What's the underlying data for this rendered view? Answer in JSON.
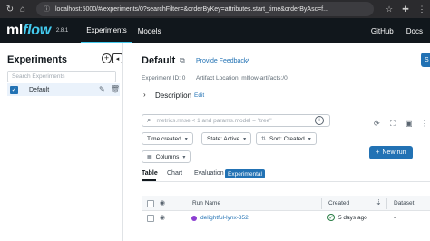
{
  "browser": {
    "url": "localhost:5000/#/experiments/0?searchFilter=&orderByKey=attributes.start_time&orderByAsc=f..."
  },
  "header": {
    "logo_ml": "ml",
    "logo_flow": "flow",
    "version": "2.8.1",
    "tabs": [
      {
        "label": "Experiments",
        "active": true
      },
      {
        "label": "Models",
        "active": false
      }
    ],
    "github": "GitHub",
    "docs": "Docs"
  },
  "sidebar": {
    "title": "Experiments",
    "search_placeholder": "Search Experiments",
    "items": [
      {
        "label": "Default",
        "checked": true
      }
    ]
  },
  "main": {
    "title": "Default",
    "feedback": "Provide Feedback",
    "experiment_id": "Experiment ID: 0",
    "artifact_location": "Artifact Location: mlflow-artifacts:/0",
    "description_label": "Description",
    "description_edit": "Edit",
    "share_label": "S",
    "filter_placeholder": "metrics.rmse < 1 and params.model = \"tree\"",
    "controls": {
      "time_created": "Time created",
      "state": "State: Active",
      "sort": "Sort: Created",
      "columns": "Columns",
      "new_run": "New run"
    },
    "view_tabs": [
      {
        "label": "Table",
        "active": true
      },
      {
        "label": "Chart",
        "active": false
      },
      {
        "label": "Evaluation",
        "active": false
      }
    ],
    "experimental_badge": "Experimental",
    "table": {
      "columns": [
        "Run Name",
        "Created",
        "Dataset"
      ],
      "rows": [
        {
          "run_name": "delightful-lynx-352",
          "created": "5 days ago",
          "dataset": "-"
        }
      ]
    }
  },
  "colors": {
    "accent": "#2272b4",
    "header_bg": "#11171c",
    "logo_flow": "#43c9ed",
    "run_dot": "#8c3fd1",
    "success": "#277c43"
  }
}
